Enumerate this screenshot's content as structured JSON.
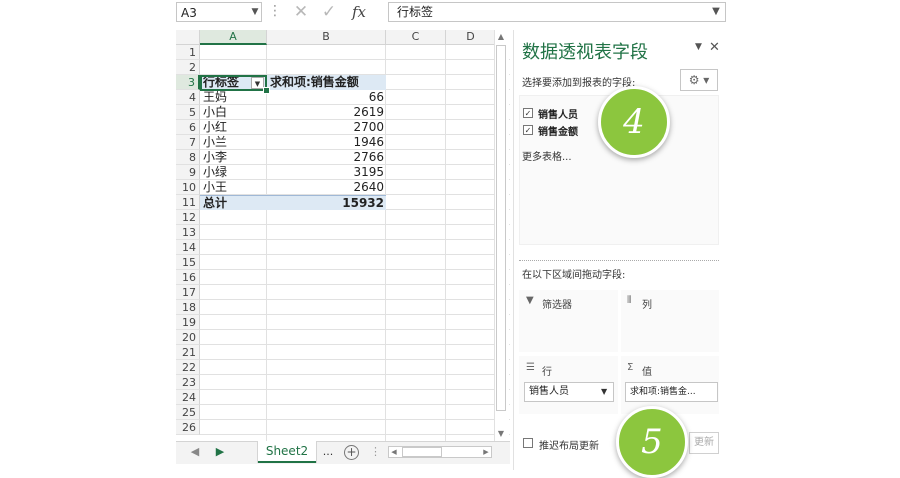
{
  "formula_bar": {
    "name_box": "A3",
    "fx_label": "fx",
    "content": "行标签"
  },
  "grid": {
    "columns": [
      "A",
      "B",
      "C",
      "D"
    ],
    "row_numbers": [
      "1",
      "2",
      "3",
      "4",
      "5",
      "6",
      "7",
      "8",
      "9",
      "10",
      "11",
      "12",
      "13",
      "14",
      "15",
      "16",
      "17",
      "18",
      "19",
      "20",
      "21",
      "22",
      "23",
      "24",
      "25",
      "26"
    ],
    "pivot_header": {
      "row_label": "行标签",
      "value_label": "求和项:销售金额"
    },
    "pivot_rows": [
      {
        "name": "王妈",
        "value": "66"
      },
      {
        "name": "小白",
        "value": "2619"
      },
      {
        "name": "小红",
        "value": "2700"
      },
      {
        "name": "小兰",
        "value": "1946"
      },
      {
        "name": "小李",
        "value": "2766"
      },
      {
        "name": "小绿",
        "value": "3195"
      },
      {
        "name": "小王",
        "value": "2640"
      }
    ],
    "pivot_total": {
      "name": "总计",
      "value": "15932"
    }
  },
  "sheet_tabs": {
    "active": "Sheet2",
    "more": "..."
  },
  "pivot_pane": {
    "title": "数据透视表字段",
    "subtitle": "选择要添加到报表的字段:",
    "fields": [
      {
        "label": "销售人员",
        "checked": true
      },
      {
        "label": "销售金额",
        "checked": true
      }
    ],
    "more_tables": "更多表格...",
    "drag_label": "在以下区域间拖动字段:",
    "areas": {
      "filters": {
        "title": "筛选器"
      },
      "columns": {
        "title": "列"
      },
      "rows": {
        "title": "行",
        "item": "销售人员"
      },
      "values": {
        "title": "值",
        "item": "求和项:销售金..."
      }
    },
    "defer_label": "推迟布局更新",
    "update_button": "更新"
  },
  "callouts": {
    "step4": "4",
    "step5": "5"
  },
  "colors": {
    "accent": "#217346",
    "pivot_fill": "#dde9f4",
    "badge": "#8cc63e"
  },
  "icons": [
    "dropdown-arrow-icon",
    "cancel-icon",
    "enter-icon",
    "fx-icon",
    "gear-icon",
    "close-icon",
    "filter-icon",
    "columns-icon",
    "rows-icon",
    "sigma-icon",
    "add-sheet-icon"
  ]
}
